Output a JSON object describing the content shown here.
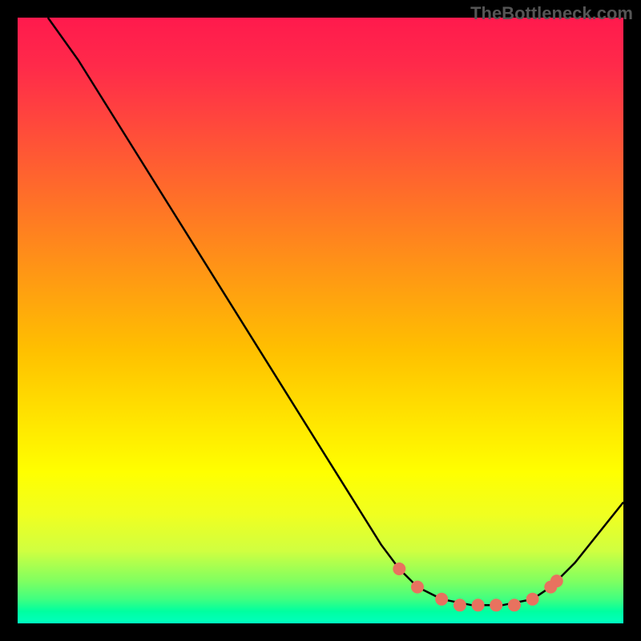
{
  "watermark": "TheBottleneck.com",
  "chart_data": {
    "type": "line",
    "title": "",
    "xlabel": "",
    "ylabel": "",
    "xlim": [
      0,
      100
    ],
    "ylim": [
      0,
      100
    ],
    "grid": false,
    "legend": false,
    "background": "gradient-vertical",
    "background_colors": [
      "#ff1a4d",
      "#ffff00",
      "#00ffc0"
    ],
    "series": [
      {
        "name": "curve",
        "color": "#000000",
        "x": [
          5,
          10,
          15,
          20,
          25,
          30,
          35,
          40,
          45,
          50,
          55,
          60,
          63,
          66,
          70,
          75,
          80,
          85,
          88,
          92,
          100
        ],
        "y": [
          100,
          93,
          85,
          77,
          69,
          61,
          53,
          45,
          37,
          29,
          21,
          13,
          9,
          6,
          4,
          3,
          3,
          4,
          6,
          10,
          20
        ]
      }
    ],
    "markers": [
      {
        "x": 63,
        "y": 9
      },
      {
        "x": 66,
        "y": 6
      },
      {
        "x": 70,
        "y": 4
      },
      {
        "x": 73,
        "y": 3
      },
      {
        "x": 76,
        "y": 3
      },
      {
        "x": 79,
        "y": 3
      },
      {
        "x": 82,
        "y": 3
      },
      {
        "x": 85,
        "y": 4
      },
      {
        "x": 88,
        "y": 6
      },
      {
        "x": 89,
        "y": 7
      }
    ],
    "marker_color": "#e8725f"
  }
}
